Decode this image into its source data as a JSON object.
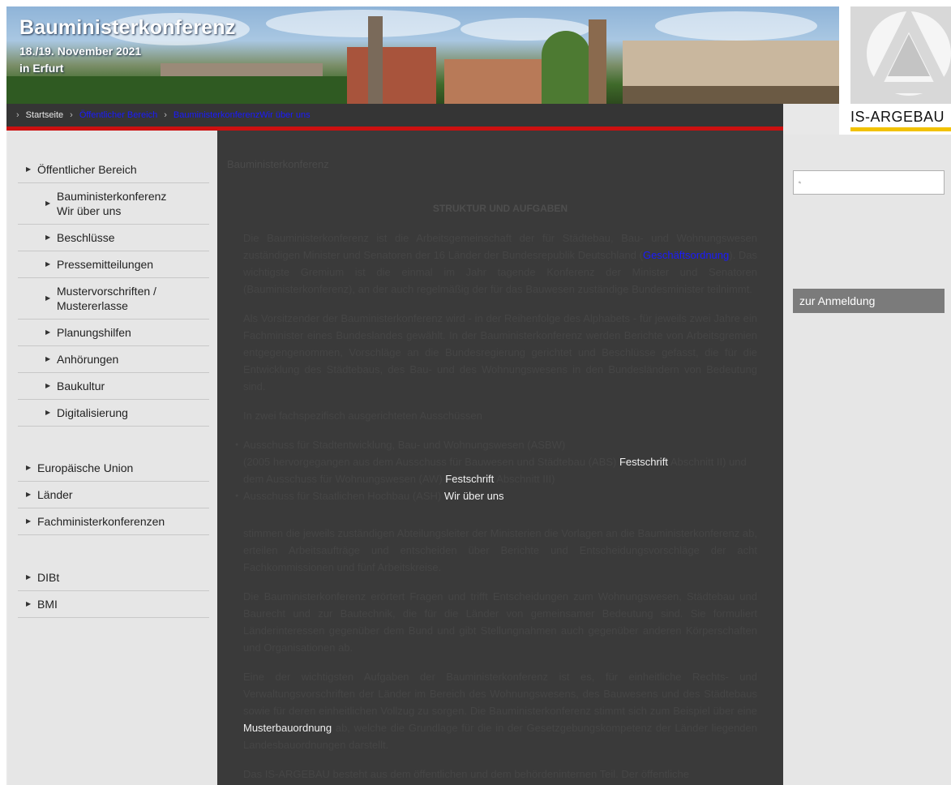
{
  "header": {
    "title": "Bauministerkonferenz",
    "date": "18./19. November 2021",
    "place": "in Erfurt",
    "logo_text": "IS-ARGEBAU"
  },
  "breadcrumb": {
    "home": "Startseite",
    "items": [
      "Öffentlicher Bereich",
      "BauministerkonferenzWir über uns"
    ]
  },
  "sidebar": {
    "group1": [
      {
        "label": "Öffentlicher Bereich",
        "sub": false
      },
      {
        "label": "Bauministerkonferenz",
        "label2": "Wir über uns",
        "sub": true
      },
      {
        "label": "Beschlüsse",
        "sub": true
      },
      {
        "label": "Pressemitteilungen",
        "sub": true
      },
      {
        "label": "Mustervorschriften /",
        "label2": "Mustererlasse",
        "sub": true
      },
      {
        "label": "Planungshilfen",
        "sub": true
      },
      {
        "label": "Anhörungen",
        "sub": true
      },
      {
        "label": "Baukultur",
        "sub": true
      },
      {
        "label": "Digitalisierung",
        "sub": true
      }
    ],
    "group2": [
      "Europäische Union",
      "Länder",
      "Fachministerkonferenzen"
    ],
    "group3": [
      "DIBt",
      "BMI"
    ]
  },
  "main": {
    "crumb_head": "Bauministerkonferenz",
    "section_title": "STRUKTUR UND AUFGABEN",
    "p1a": "Die Bauministerkonferenz ist die Arbeitsgemeinschaft der für Städtebau, Bau- und Wohnungswesen zuständigen Minister und Senatoren der 16 Länder der Bundesrepublik Deutschland (",
    "p1_link": "Geschäftsordnung",
    "p1b": "). Das wichtigste Gremium ist die einmal im Jahr tagende Konferenz der Minister und Senatoren (Bauministerkonferenz), an der auch regelmäßig der für das Bauwesen zuständige Bundesminister teilnimmt.",
    "p2": "Als Vorsitzender der Bauministerkonferenz wird - in der Reihenfolge des Alphabets - für jeweils zwei Jahre ein Fachminister eines Bundeslandes gewählt. In der Bauministerkonferenz werden Berichte von Arbeitsgremien entgegengenommen, Vorschläge an die Bundesregierung gerichtet und Beschlüsse gefasst, die für die Entwicklung des Städtebaus, des Bau- und des Wohnungswesens in den Bundesländern von Bedeutung sind.",
    "p3": "In zwei fachspezifisch ausgerichteten Ausschüssen",
    "li1a": "Ausschuss für Stadtentwicklung, Bau- und Wohnungswesen (ASBW)",
    "li1b": "(2005 hervorgegangen aus dem Ausschuss für Bauwesen und Städtebau (ABS) ",
    "li1_link1": "Festschrift",
    "li1c": " Abschnitt II) und dem Ausschuss für Wohnungswesen (AW) ",
    "li1_link2": "Festschrift",
    "li1d": " Abschnitt III)",
    "li2a": "Ausschuss für Staatlichen Hochbau (ASH) ",
    "li2_link": "Wir über uns",
    "p4": "stimmen die jeweils zuständigen Abteilungsleiter der Ministerien die Vorlagen an die Bauministerkonferenz ab, erteilen Arbeitsaufträge und entscheiden über Berichte und Entscheidungsvorschläge der acht Fachkommissionen und fünf Arbeitskreise.",
    "p5": "Die Bauministerkonferenz erörtert Fragen und trifft Entscheidungen zum Wohnungswesen, Städtebau und Baurecht und zur Bautechnik, die für die Länder von gemeinsamer Bedeutung sind. Sie formuliert Länderinteressen gegenüber dem Bund und gibt Stellungnahmen auch gegenüber anderen Körperschaften und Organisationen ab.",
    "p6a": "Eine der wichtigsten Aufgaben der Bauministerkonferenz ist es, für einheitliche Rechts- und Verwaltungsvorschriften der Länder im Bereich des Wohnungswesens, des Bauwesens und des Städtebaus sowie für deren einheitlichen Vollzug zu sorgen. Die Bauministerkonferenz stimmt sich zum Beispiel über eine ",
    "p6_link": "Musterbauordnung",
    "p6b": " ab, welche die Grundlage für die in der Gesetzgebungskompetenz der Länder liegenden Landesbauordnungen darstellt.",
    "p7": "Das IS-ARGEBAU besteht aus dem öffentlichen und dem behördeninternen Teil. Der öffentliche"
  },
  "rightcol": {
    "search_placeholder": "",
    "login_label": "zur Anmeldung"
  }
}
